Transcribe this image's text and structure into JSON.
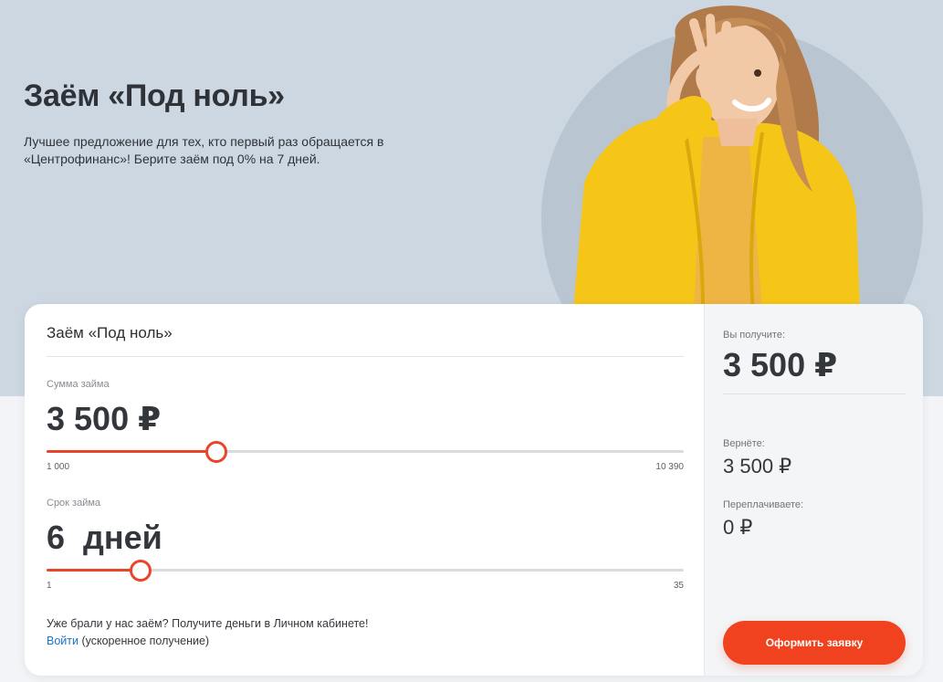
{
  "hero": {
    "title": "Заём «Под ноль»",
    "description": "Лучшее предложение для тех, кто первый раз обращается в «Центрофинанс»! Берите заём под 0% на 7 дней."
  },
  "calculator": {
    "title": "Заём «Под ноль»",
    "amount": {
      "label": "Сумма займа",
      "value": "3 500 ₽",
      "min_label": "1 000",
      "max_label": "10 390",
      "min": 1000,
      "max": 10390,
      "current": 3500
    },
    "term": {
      "label": "Срок займа",
      "value": "6  дней",
      "min_label": "1",
      "max_label": "35",
      "min": 1,
      "max": 35,
      "current": 6
    },
    "note_text": "Уже брали у нас заём? Получите деньги в Личном кабинете!",
    "login_link": "Войти",
    "login_suffix": " (ускоренное получение)"
  },
  "summary": {
    "receive_label": "Вы получите:",
    "receive_value": "3 500 ₽",
    "return_label": "Вернёте:",
    "return_value": "3 500 ₽",
    "overpay_label": "Переплачиваете:",
    "overpay_value": "0 ₽",
    "apply_button": "Оформить заявку"
  },
  "colors": {
    "accent": "#e8452a",
    "button": "#f0421e",
    "hero_bg": "#ccd7e2",
    "link": "#1a73c9"
  }
}
